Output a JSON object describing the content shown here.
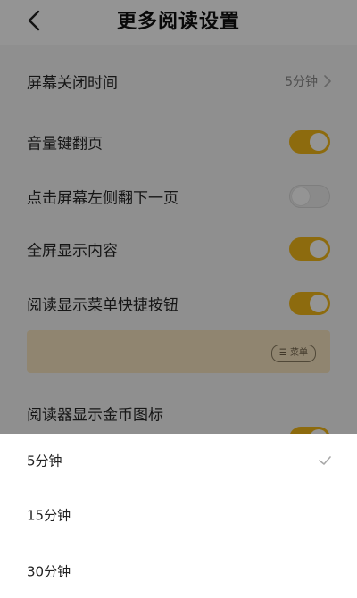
{
  "header": {
    "back_icon": "chevron-left-icon",
    "title": "更多阅读设置"
  },
  "settings": {
    "screen_off": {
      "label": "屏幕关闭时间",
      "value": "5分钟"
    },
    "volume_key_page": {
      "label": "音量键翻页",
      "enabled": true
    },
    "tap_left_next": {
      "label": "点击屏幕左侧翻下一页",
      "enabled": false
    },
    "fullscreen": {
      "label": "全屏显示内容",
      "enabled": true
    },
    "menu_shortcut": {
      "label": "阅读显示菜单快捷按钮",
      "enabled": true,
      "preview_pill": "☰ 菜单"
    },
    "coin_icon": {
      "label": "阅读器显示金币图标",
      "enabled": true
    }
  },
  "picker": {
    "options": [
      {
        "label": "5分钟",
        "selected": true
      },
      {
        "label": "15分钟",
        "selected": false
      },
      {
        "label": "30分钟",
        "selected": false
      }
    ]
  },
  "colors": {
    "accent": "#f3b819",
    "overlay": "rgba(0,0,0,0.42)",
    "preview_card": "#f9e6c2"
  }
}
